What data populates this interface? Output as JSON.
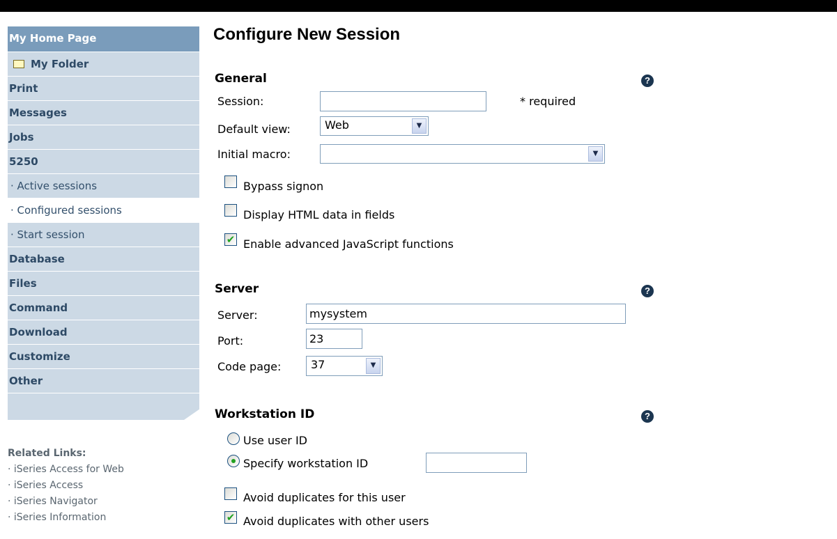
{
  "page": {
    "title": "Configure New Session"
  },
  "sidebar": {
    "home": "My Home Page",
    "folder": "My Folder",
    "items": [
      {
        "label": "Print"
      },
      {
        "label": "Messages"
      },
      {
        "label": "Jobs"
      },
      {
        "label": "5250"
      }
    ],
    "sub_items": [
      {
        "label": "· Active sessions"
      },
      {
        "label": "· Configured sessions"
      },
      {
        "label": "· Start session"
      }
    ],
    "items_after": [
      {
        "label": "Database"
      },
      {
        "label": "Files"
      },
      {
        "label": "Command"
      },
      {
        "label": "Download"
      },
      {
        "label": "Customize"
      },
      {
        "label": "Other"
      }
    ]
  },
  "related": {
    "title": "Related Links:",
    "links": [
      "· iSeries Access for Web",
      "· iSeries Access",
      "· iSeries Navigator",
      "· iSeries Information"
    ]
  },
  "general": {
    "title": "General",
    "session_label": "Session:",
    "session_value": "",
    "required_note": "* required",
    "default_view_label": "Default view:",
    "default_view_value": "Web",
    "initial_macro_label": "Initial macro:",
    "initial_macro_value": "",
    "bypass_signon": {
      "label": "Bypass signon",
      "checked": false
    },
    "display_html": {
      "label": "Display HTML data in fields",
      "checked": false
    },
    "enable_js": {
      "label": "Enable advanced JavaScript functions",
      "checked": true
    }
  },
  "server": {
    "title": "Server",
    "server_label": "Server:",
    "server_value": "mysystem",
    "port_label": "Port:",
    "port_value": "23",
    "code_page_label": "Code page:",
    "code_page_value": "37"
  },
  "workstation": {
    "title": "Workstation ID",
    "use_user_id": {
      "label": "Use user ID",
      "selected": false
    },
    "specify_id": {
      "label": "Specify workstation ID",
      "selected": true
    },
    "workstation_value": "",
    "avoid_user": {
      "label": "Avoid duplicates for this user",
      "checked": false
    },
    "avoid_others": {
      "label": "Avoid duplicates with other users",
      "checked": true
    }
  },
  "icons": {
    "help": "help-icon",
    "folder": "folder-icon",
    "dropdown": "chevron-down-icon",
    "check": "check-icon"
  },
  "colors": {
    "nav_bg": "#ccd9e5",
    "nav_home_bg": "#7a9cbb",
    "nav_text": "#2e4a66",
    "check": "#21a121"
  }
}
